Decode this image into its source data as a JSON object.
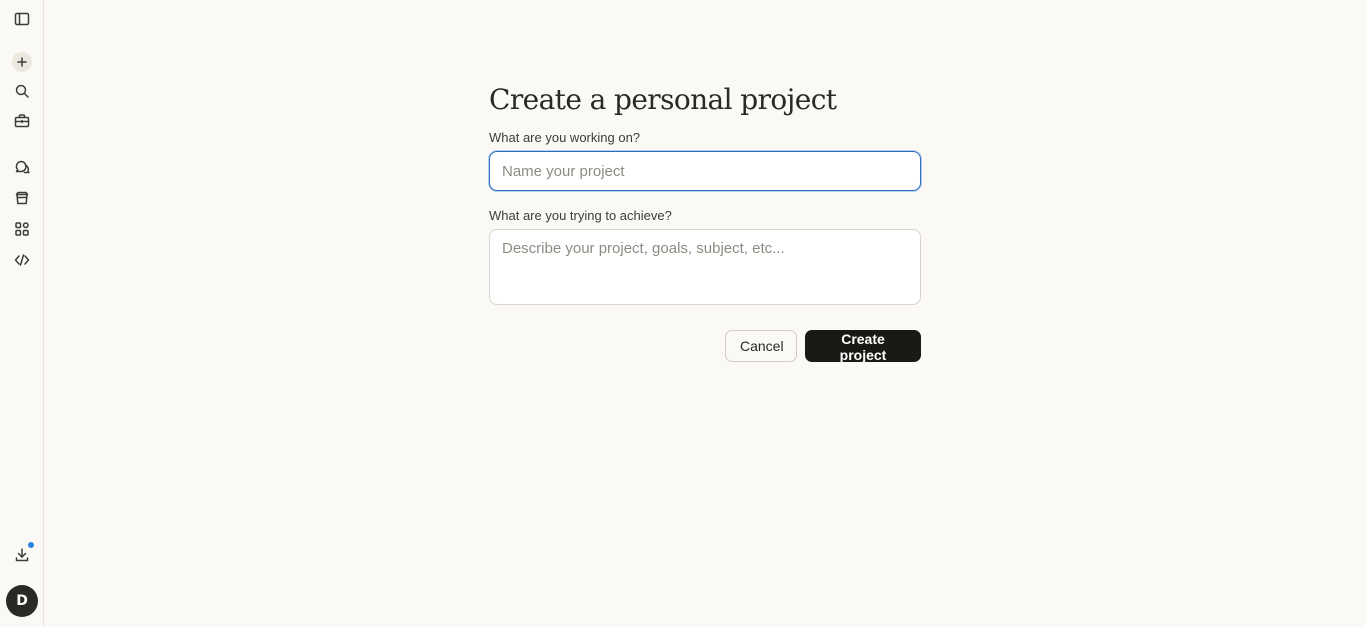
{
  "sidebar": {
    "icons": {
      "toggle": "sidebar-toggle-icon",
      "new_chat": "plus-icon",
      "search": "search-icon",
      "projects": "briefcase-icon",
      "chats": "chat-bubbles-icon",
      "artifacts": "archive-box-icon",
      "apps": "grid-apps-icon",
      "code": "code-brackets-icon",
      "download": "download-icon"
    },
    "avatar_initial": "D",
    "notification_color": "#2c84db"
  },
  "form": {
    "title": "Create a personal project",
    "name_label": "What are you working on?",
    "name_placeholder": "Name your project",
    "name_value": "",
    "description_label": "What are you trying to achieve?",
    "description_placeholder": "Describe your project, goals, subject, etc...",
    "description_value": "",
    "cancel_label": "Cancel",
    "create_label": "Create project"
  },
  "colors": {
    "background": "#faf9f5",
    "primary_button": "#1a1915",
    "focus_ring": "#2c6fc2"
  }
}
